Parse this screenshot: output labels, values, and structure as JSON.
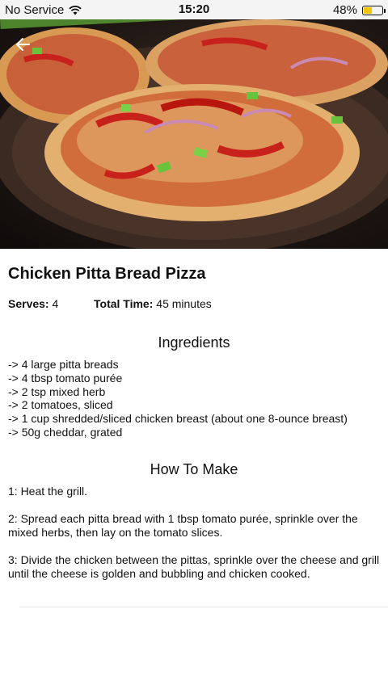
{
  "status_bar": {
    "carrier": "No Service",
    "time": "15:20",
    "battery_percent": "48%",
    "battery_level": 0.48,
    "battery_color": "#f2c500"
  },
  "hero": {
    "image": "pizza-photo",
    "back_icon": "back-arrow-icon"
  },
  "recipe": {
    "title": "Chicken Pitta Bread Pizza",
    "serves_label": "Serves:",
    "serves_value": "4",
    "time_label": "Total Time:",
    "time_value": "45 minutes",
    "ingredients_heading": "Ingredients",
    "ingredients": [
      "-> 4 large pitta breads",
      "-> 4 tbsp tomato purée",
      "-> 2 tsp mixed herb",
      "-> 2 tomatoes, sliced",
      "-> 1 cup shredded/sliced chicken breast (about one 8-ounce breast)",
      "-> 50g cheddar, grated"
    ],
    "method_heading": "How To Make",
    "steps": [
      "1: Heat the grill.",
      "2: Spread each pitta bread with 1 tbsp tomato purée, sprinkle over the mixed herbs, then lay on the tomato slices.",
      "3: Divide the chicken between the pittas, sprinkle over the cheese and grill until the cheese is golden and bubbling and chicken cooked."
    ]
  }
}
